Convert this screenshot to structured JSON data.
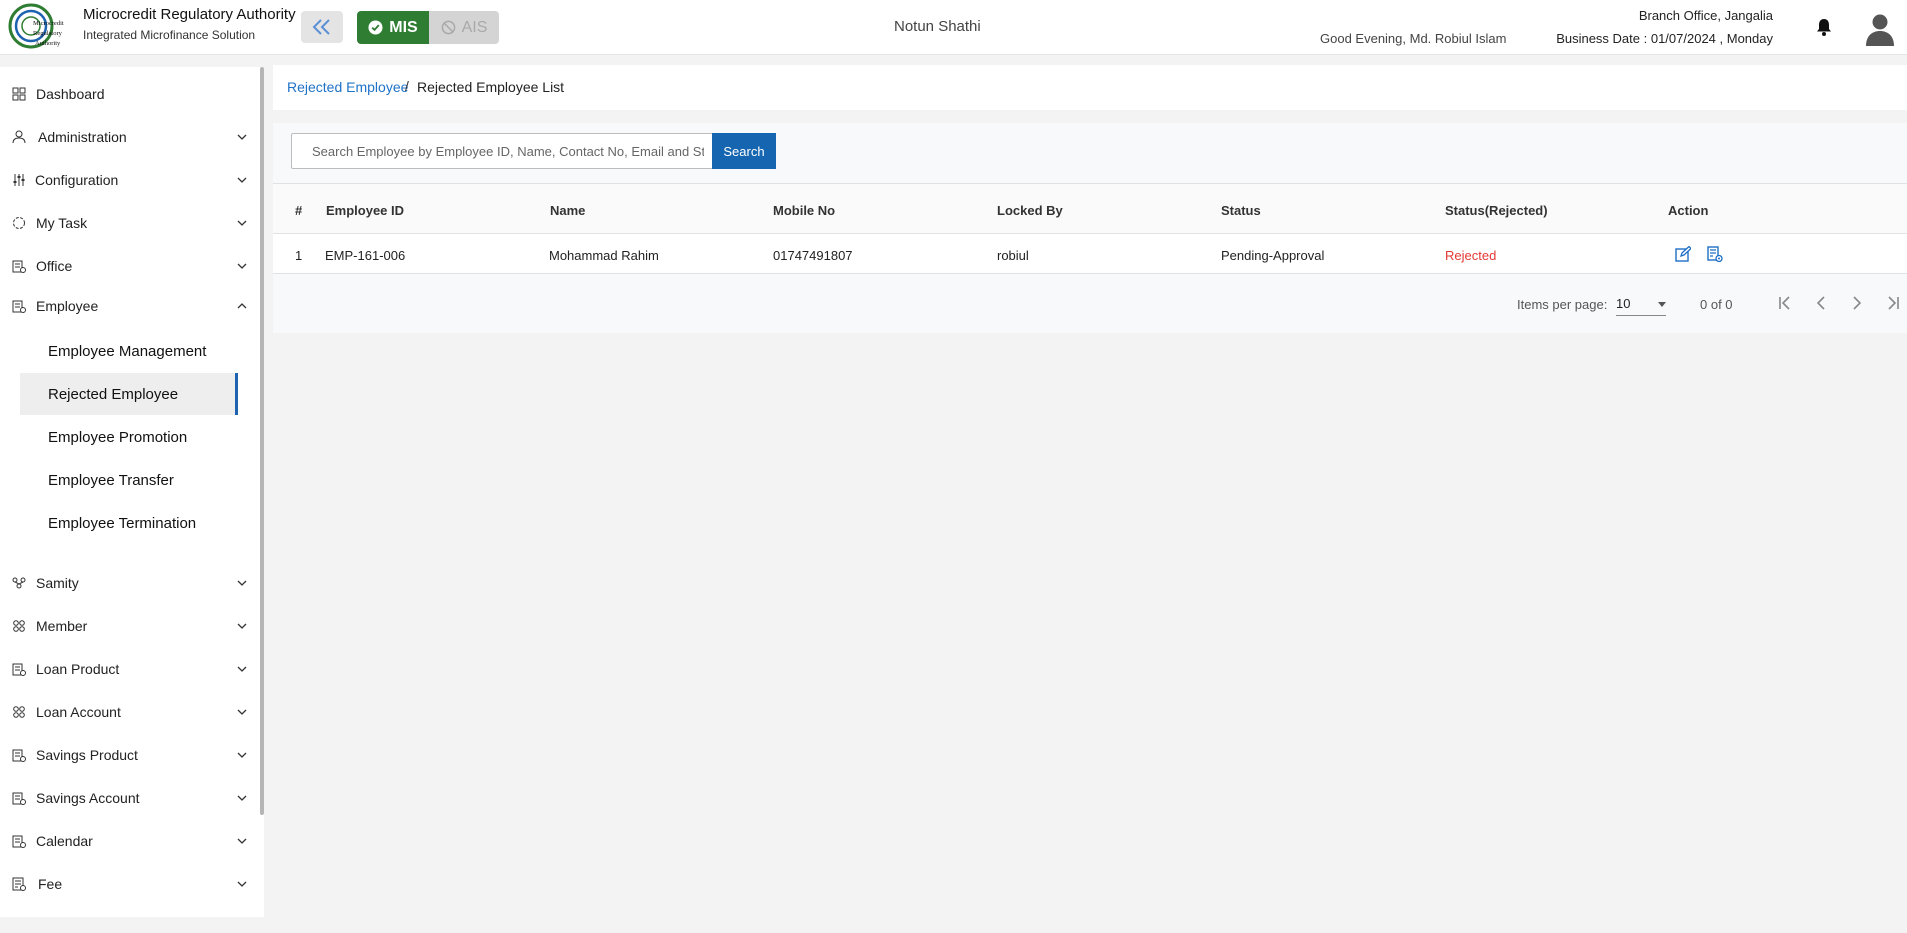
{
  "header": {
    "org_title": "Microcredit Regulatory Authority",
    "org_subtitle": "Integrated Microfinance Solution",
    "logo_text": [
      "Microcredit",
      "Regulatory",
      "Authority"
    ],
    "modes": {
      "mis": "MIS",
      "ais": "AIS"
    },
    "center_name": "Notun Shathi",
    "greeting": "Good Evening, Md. Robiul Islam",
    "branch": "Branch Office, Jangalia",
    "business_date": "Business Date : 01/07/2024 , Monday",
    "accent_color": "#2e7d32"
  },
  "sidebar": {
    "items": [
      {
        "label": "Dashboard",
        "icon": "dashboard-icon"
      },
      {
        "label": "Administration",
        "icon": "admin-icon"
      },
      {
        "label": "Configuration",
        "icon": "config-icon"
      },
      {
        "label": "My Task",
        "icon": "task-icon"
      },
      {
        "label": "Office",
        "icon": "office-icon"
      },
      {
        "label": "Employee",
        "icon": "employee-icon"
      },
      {
        "label": "Samity",
        "icon": "samity-icon"
      },
      {
        "label": "Member",
        "icon": "member-icon"
      },
      {
        "label": "Loan Product",
        "icon": "loan-product-icon"
      },
      {
        "label": "Loan Account",
        "icon": "loan-account-icon"
      },
      {
        "label": "Savings Product",
        "icon": "savings-product-icon"
      },
      {
        "label": "Savings Account",
        "icon": "savings-account-icon"
      },
      {
        "label": "Calendar",
        "icon": "calendar-icon"
      },
      {
        "label": "Fee",
        "icon": "fee-icon"
      }
    ],
    "employee_sub": [
      "Employee Management",
      "Rejected Employee",
      "Employee Promotion",
      "Employee Transfer",
      "Employee Termination"
    ],
    "active_sub": "Rejected Employee"
  },
  "breadcrumb": {
    "parent": "Rejected Employee",
    "separator": "/",
    "current": "Rejected Employee List"
  },
  "search": {
    "placeholder": "Search Employee by Employee ID, Name, Contact No, Email and Status",
    "button": "Search"
  },
  "table": {
    "columns": [
      "#",
      "Employee ID",
      "Name",
      "Mobile No",
      "Locked By",
      "Status",
      "Status(Rejected)",
      "Action"
    ],
    "rows": [
      {
        "no": "1",
        "employee_id": "EMP-161-006",
        "name": "Mohammad Rahim",
        "mobile": "01747491807",
        "locked_by": "robiul",
        "status": "Pending-Approval",
        "status_rejected": "Rejected"
      }
    ],
    "rejected_color": "#e53935"
  },
  "paginator": {
    "items_per_page_label": "Items per page:",
    "items_per_page": "10",
    "range": "0 of 0"
  }
}
